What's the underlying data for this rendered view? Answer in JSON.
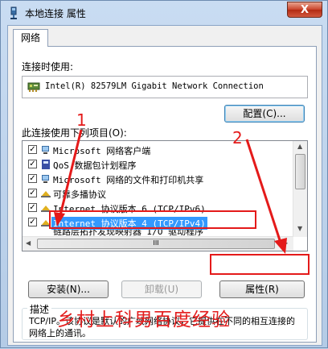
{
  "window": {
    "title": "本地连接 属性",
    "close_label": "X"
  },
  "tabs": [
    {
      "label": "网络",
      "active": true
    }
  ],
  "connect_using": {
    "label": "连接时使用:",
    "adapter": "Intel(R) 82579LM Gigabit Network Connection",
    "configure_button": "配置(C)..."
  },
  "items_section": {
    "label": "此连接使用下列项目(O):",
    "items": [
      {
        "label": "Microsoft 网络客户端",
        "checked": true,
        "icon": "network-client-icon"
      },
      {
        "label": "QoS 数据包计划程序",
        "checked": true,
        "icon": "qos-scheduler-icon"
      },
      {
        "label": "Microsoft 网络的文件和打印机共享",
        "checked": true,
        "icon": "file-printer-sharing-icon"
      },
      {
        "label": "可靠多播协议",
        "checked": true,
        "icon": "protocol-icon"
      },
      {
        "label": "Internet 协议版本 6 (TCP/IPv6)",
        "checked": true,
        "icon": "protocol-icon"
      },
      {
        "label": "Internet 协议版本 4 (TCP/IPv4)",
        "checked": true,
        "icon": "protocol-icon",
        "selected": true
      },
      {
        "label": "链路层拓扑发现映射器 I/O 驱动程序",
        "checked": true,
        "icon": "protocol-icon"
      }
    ],
    "hscroll_grip": "III"
  },
  "buttons": {
    "install": "安装(N)...",
    "uninstall": "卸载(U)",
    "properties": "属性(R)"
  },
  "description": {
    "legend": "描述",
    "text": "TCP/IP。该协议是默认的广域网络协议，它提供在不同的相互连接的网络上的通讯。"
  },
  "annotations": {
    "marker_1": "1",
    "marker_2": "2",
    "watermark": "乡村上科男百度经验"
  },
  "colors": {
    "highlight": "#3399ff",
    "annotation_red": "#e41a1a"
  }
}
